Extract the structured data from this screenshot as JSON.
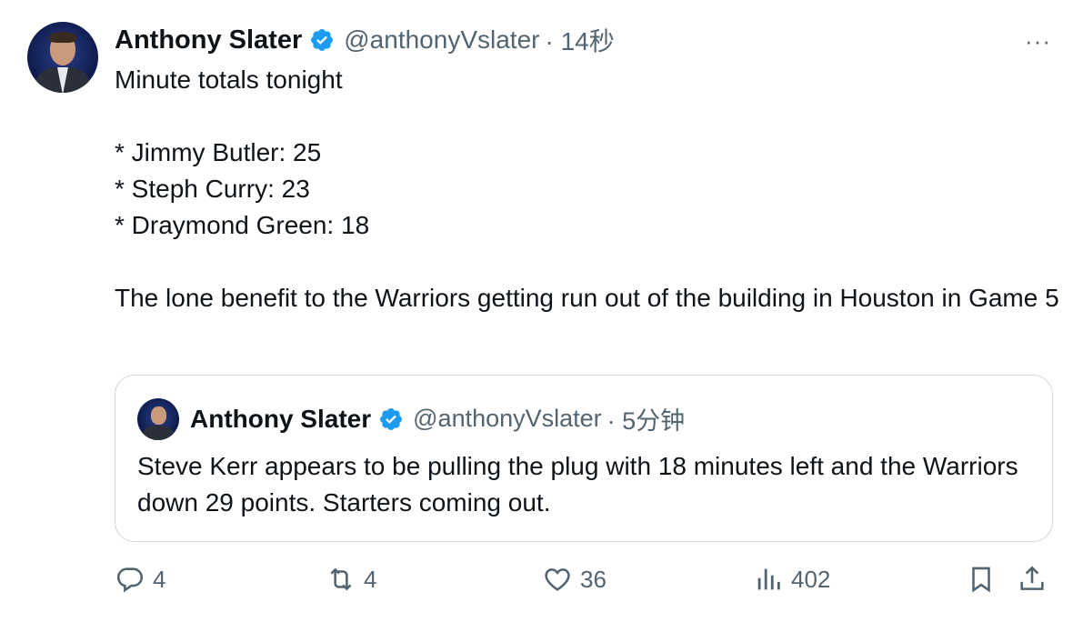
{
  "tweet": {
    "author_name": "Anthony Slater",
    "handle": "@anthonyVslater",
    "time": "· 14秒",
    "lines": [
      "Minute totals tonight",
      "* Jimmy Butler: 25",
      "* Steph Curry: 23",
      "* Draymond Green: 18",
      "The lone benefit to the Warriors getting run out of the building in Houston in Game 5"
    ],
    "more_label": "···"
  },
  "quote": {
    "author_name": "Anthony Slater",
    "handle": "@anthonyVslater",
    "time": "· 5分钟",
    "text": "Steve Kerr appears to be pulling the plug with 18 minutes left and the Warriors down 29 points. Starters coming out."
  },
  "actions": {
    "replies": "4",
    "reposts": "4",
    "likes": "36",
    "views": "402"
  },
  "icons": {
    "verified": "verified-badge-icon",
    "reply": "reply-icon",
    "repost": "repost-icon",
    "like": "heart-icon",
    "views": "views-chart-icon",
    "bookmark": "bookmark-icon",
    "share": "share-icon"
  },
  "colors": {
    "verified": "#1d9bf0",
    "text": "#0f1419",
    "muted": "#536471",
    "border": "#cfd9de"
  }
}
